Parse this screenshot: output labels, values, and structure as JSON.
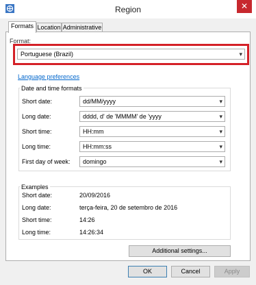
{
  "window": {
    "title": "Region",
    "close_glyph": "✕"
  },
  "tabs": [
    {
      "label": "Formats"
    },
    {
      "label": "Location"
    },
    {
      "label": "Administrative"
    }
  ],
  "format": {
    "label": "Format:",
    "value": "Portuguese (Brazil)"
  },
  "language_link": "Language preferences",
  "date_time": {
    "title": "Date and time formats",
    "rows": [
      {
        "label": "Short date:",
        "value": "dd/MM/yyyy"
      },
      {
        "label": "Long date:",
        "value": "dddd, d' de 'MMMM' de 'yyyy"
      },
      {
        "label": "Short time:",
        "value": "HH:mm"
      },
      {
        "label": "Long time:",
        "value": "HH:mm:ss"
      },
      {
        "label": "First day of week:",
        "value": "domingo"
      }
    ]
  },
  "examples": {
    "title": "Examples",
    "rows": [
      {
        "label": "Short date:",
        "value": "20/09/2016"
      },
      {
        "label": "Long date:",
        "value": "terça-feira, 20 de setembro de 2016"
      },
      {
        "label": "Short time:",
        "value": "14:26"
      },
      {
        "label": "Long time:",
        "value": "14:26:34"
      }
    ]
  },
  "buttons": {
    "additional": "Additional settings...",
    "ok": "OK",
    "cancel": "Cancel",
    "apply": "Apply"
  },
  "icons": {
    "app": "region-icon",
    "dropdown": "chevron-down-icon"
  },
  "colors": {
    "highlight": "#d42027",
    "link": "#0066cc",
    "close": "#c7282e"
  }
}
